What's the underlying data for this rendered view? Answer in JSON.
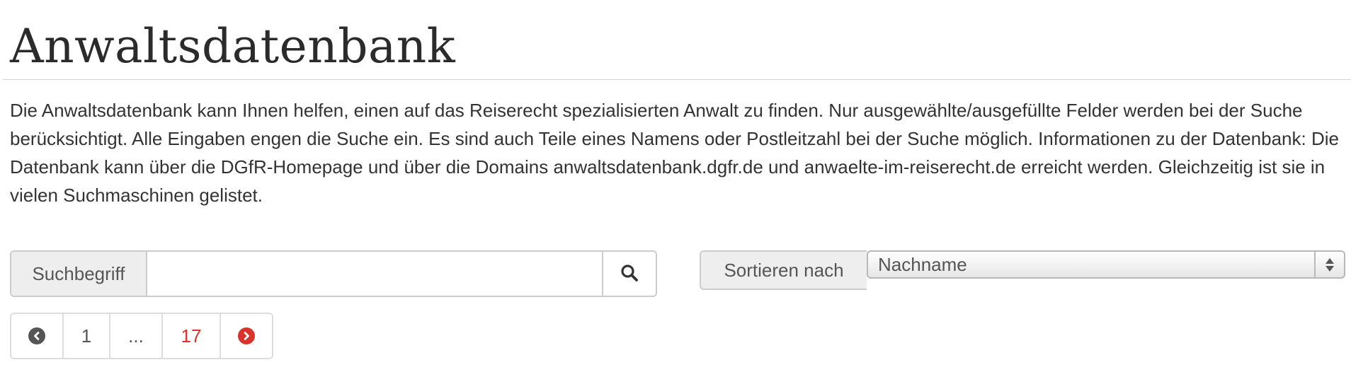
{
  "header": {
    "title": "Anwaltsdatenbank",
    "description": "Die Anwaltsdatenbank kann Ihnen helfen, einen auf das Reiserecht spezialisierten Anwalt zu finden. Nur ausgewählte/ausgefüllte Felder werden bei der Suche berücksichtigt. Alle Eingaben engen die Suche ein. Es sind auch Teile eines Namens oder Postleitzahl bei der Suche möglich. Informationen zu der Datenbank: Die Datenbank kann über die DGfR-Homepage und über die Domains anwaltsdatenbank.dgfr.de und anwaelte-im-reiserecht.de erreicht werden. Gleichzeitig ist sie in vielen Suchmaschinen gelistet."
  },
  "search": {
    "label": "Suchbegriff",
    "value": "",
    "placeholder": "",
    "button_icon": "search-icon"
  },
  "sort": {
    "label": "Sortieren nach",
    "selected": "Nachname"
  },
  "pagination": {
    "prev_icon": "chevron-left-circle-icon",
    "pages": [
      "1",
      "...",
      "17"
    ],
    "next_icon": "chevron-right-circle-icon",
    "accent_color": "#d9342b",
    "muted_icon_color": "#555555"
  },
  "colors": {
    "text": "#333333",
    "border": "#cccccc",
    "addon_background": "#eeeeee",
    "accent": "#d9342b"
  }
}
